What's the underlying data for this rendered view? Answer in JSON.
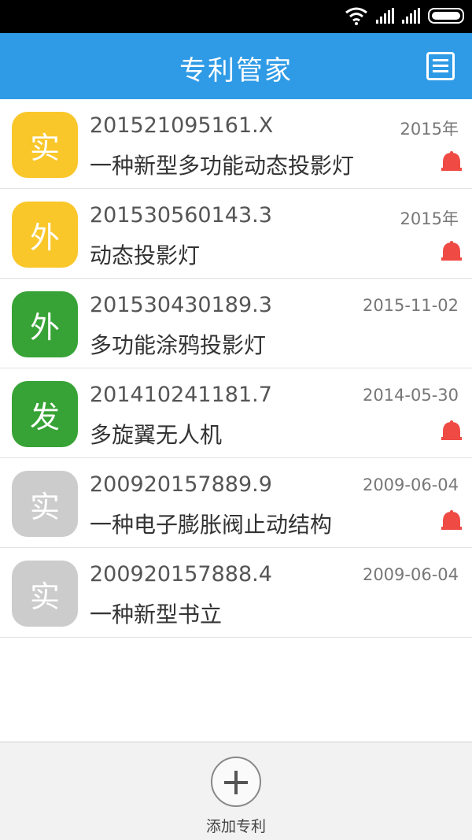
{
  "app": {
    "title": "专利管家"
  },
  "status_bar": {
    "icons": [
      "wifi-icon",
      "signal-icon",
      "signal-icon",
      "battery-icon"
    ]
  },
  "header": {
    "menu_icon": "list-menu-icon"
  },
  "colors": {
    "primary": "#2f9be6",
    "yellow": "#f9c72a",
    "green": "#37a336",
    "gray": "#cccccc",
    "alert": "#ef4a44"
  },
  "patents": [
    {
      "badge": "实",
      "badge_color": "#f9c72a",
      "number": "201521095161.X",
      "date": "2015年",
      "name": "一种新型多功能动态投影灯",
      "alert": true
    },
    {
      "badge": "外",
      "badge_color": "#f9c72a",
      "number": "201530560143.3",
      "date": "2015年",
      "name": "动态投影灯",
      "alert": true
    },
    {
      "badge": "外",
      "badge_color": "#37a336",
      "number": "201530430189.3",
      "date": "2015-11-02",
      "name": "多功能涂鸦投影灯",
      "alert": false
    },
    {
      "badge": "发",
      "badge_color": "#37a336",
      "number": "201410241181.7",
      "date": "2014-05-30",
      "name": "多旋翼无人机",
      "alert": true
    },
    {
      "badge": "实",
      "badge_color": "#cccccc",
      "number": "200920157889.9",
      "date": "2009-06-04",
      "name": "一种电子膨胀阀止动结构",
      "alert": true
    },
    {
      "badge": "实",
      "badge_color": "#cccccc",
      "number": "200920157888.4",
      "date": "2009-06-04",
      "name": "一种新型书立",
      "alert": false
    }
  ],
  "footer": {
    "add_label": "添加专利",
    "add_icon": "plus-circle-icon"
  }
}
